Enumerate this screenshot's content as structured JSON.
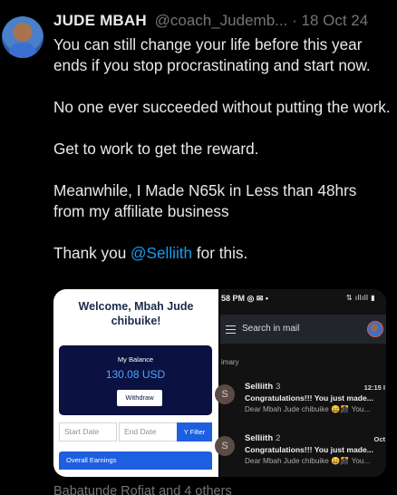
{
  "author": {
    "name": "JUDE MBAH",
    "handle": "@coach_Judemb...",
    "separator": "·",
    "date": "18 Oct 24"
  },
  "tweet": {
    "p1": "You can still change your life before this year ends if you stop procrastinating and start now.",
    "p2": "No one ever succeeded without putting the work.",
    "p3": "Get to work to get the reward.",
    "p4": "Meanwhile, I Made N65k in Less than 48hrs from my affiliate business",
    "p5_before": "Thank you ",
    "p5_mention": "@Selliith",
    "p5_after": " for this."
  },
  "media": {
    "dashboard": {
      "welcome": "Welcome, Mbah Jude chibuike!",
      "balance_label": "My Balance",
      "balance_value": "130.08 USD",
      "withdraw_label": "Withdraw",
      "start_date_placeholder": "Start Date",
      "end_date_placeholder": "End Date",
      "filter_label": "Y Filter",
      "overall_earnings_label": "Overall Earnings"
    },
    "gmail": {
      "status_time": "58 PM",
      "search_placeholder": "Search in mail",
      "section_label": "imary",
      "emails": [
        {
          "avatar": "S",
          "sender": "Selliith",
          "count": "3",
          "time": "12:15 I",
          "subject": "Congratulations!!! You just made...",
          "snippet": "Dear Mbah Jude chibuike 😄🎊 You..."
        },
        {
          "avatar": "S",
          "sender": "Selliith",
          "count": "2",
          "time": "Oct",
          "subject": "Congratulations!!! You just made...",
          "snippet": "Dear Mbah Jude chibuike 😄🎊 You..."
        }
      ]
    }
  },
  "footer": {
    "likes_text": "Babatunde Rofiat and 4 others"
  },
  "colors": {
    "background": "#000000",
    "text": "#e7e9ea",
    "muted": "#71767b",
    "mention": "#1d9bf0",
    "accent_blue": "#1d5fe0"
  }
}
